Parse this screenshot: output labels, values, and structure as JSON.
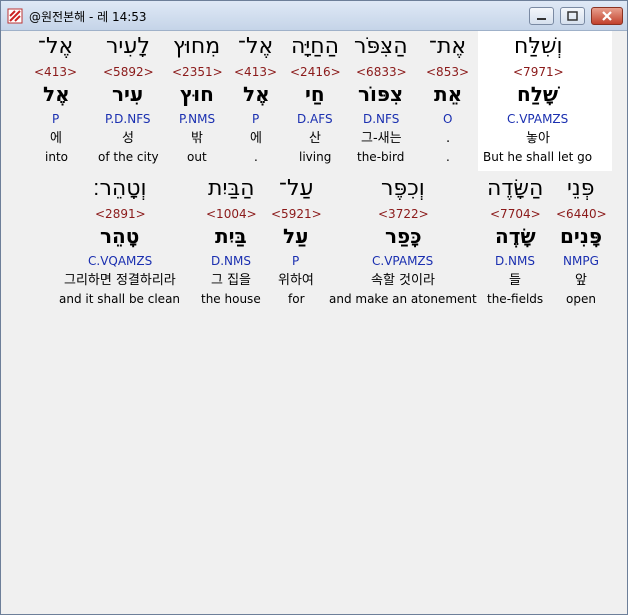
{
  "window": {
    "title": "@원전본해 - 레 14:53"
  },
  "row1": [
    {
      "heb": "וְשִׁלַּח",
      "ref": "<7971>",
      "lemma": "שָׁלַח",
      "parse": "C.VPAMZS",
      "kor": "놓아",
      "eng": "But he shall let go",
      "highlight": true
    },
    {
      "heb": "אֶת־",
      "ref": "<853>",
      "lemma": "אֵת",
      "parse": "O",
      "kor": ".",
      "eng": "."
    },
    {
      "heb": "הַצִּפֹּר",
      "ref": "<6833>",
      "lemma": "צִפּוֹר",
      "parse": "D.NFS",
      "kor": "그-새는",
      "eng": "the-bird"
    },
    {
      "heb": "הַחַיָּה",
      "ref": "<2416>",
      "lemma": "חַי",
      "parse": "D.AFS",
      "kor": "산",
      "eng": "living"
    },
    {
      "heb": "אֶל־",
      "ref": "<413>",
      "lemma": "אֶל",
      "parse": "P",
      "kor": "에",
      "eng": "."
    },
    {
      "heb": "מִחוּץ",
      "ref": "<2351>",
      "lemma": "חוּץ",
      "parse": "P.NMS",
      "kor": "밖",
      "eng": "out"
    },
    {
      "heb": "לָעִיר",
      "ref": "<5892>",
      "lemma": "עִיר",
      "parse": "P.D.NFS",
      "kor": "성",
      "eng": "of the city"
    },
    {
      "heb": "אֶל־",
      "ref": "<413>",
      "lemma": "אֶל",
      "parse": "P",
      "kor": "에",
      "eng": "into"
    }
  ],
  "row2": [
    {
      "heb": "פְּנֵי",
      "ref": "<6440>",
      "lemma": "פָּנִים",
      "parse": "NMPG",
      "kor": "앞",
      "eng": "open"
    },
    {
      "heb": "הַשָּׂדֶה",
      "ref": "<7704>",
      "lemma": "שָׂדֶה",
      "parse": "D.NMS",
      "kor": "들",
      "eng": "the-fields"
    },
    {
      "heb": "וְכִפֶּר",
      "ref": "<3722>",
      "lemma": "כָּפַר",
      "parse": "C.VPAMZS",
      "kor": "속할 것이라",
      "eng": "and make an atonement"
    },
    {
      "heb": "עַל־",
      "ref": "<5921>",
      "lemma": "עַל",
      "parse": "P",
      "kor": "위하여",
      "eng": "for"
    },
    {
      "heb": "הַבַּיִת",
      "ref": "<1004>",
      "lemma": "בַּיִת",
      "parse": "D.NMS",
      "kor": "그 집을",
      "eng": "the house"
    },
    {
      "heb": "וְטָהֵר׃",
      "ref": "<2891>",
      "lemma": "טָהֵר",
      "parse": "C.VQAMZS",
      "kor": "그리하면 정결하리라",
      "eng": "and it shall be clean"
    }
  ]
}
